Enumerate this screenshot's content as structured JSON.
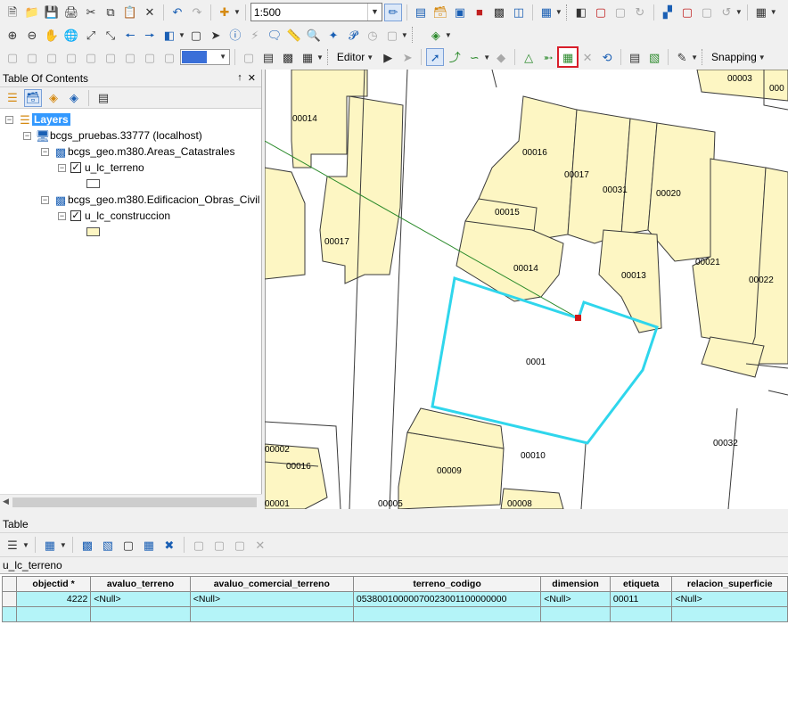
{
  "toolbar": {
    "scale": "1:500",
    "editor_label": "Editor",
    "snapping_label": "Snapping"
  },
  "toc": {
    "title": "Table Of Contents",
    "pin_glyph": "↑",
    "close_glyph": "✕",
    "layers_label": "Layers",
    "database": "bcgs_pruebas.33777 (localhost)",
    "group1": "bcgs_geo.m380.Areas_Catastrales",
    "layer1": "u_lc_terreno",
    "group2": "bcgs_geo.m380.Edificacion_Obras_Civil",
    "layer2": "u_lc_construccion",
    "layer1_swatch_color": "#ffffff",
    "layer2_swatch_color": "#fdf6c3"
  },
  "map": {
    "parcel_fill": "#fdf6c3",
    "selection_color": "#2fd6ec",
    "labels": {
      "l00014a": "00014",
      "l00003": "00003",
      "l00016": "00016",
      "l00017a": "00017",
      "l00031": "00031",
      "l00020": "00020",
      "l00015": "00015",
      "l00017b": "00017",
      "l00014b": "00014",
      "l00013": "00013",
      "l00021": "00021",
      "l00022": "00022",
      "l00011": "0001",
      "l00032": "00032",
      "l00002": "00002",
      "l00016b": "00016",
      "l00009": "00009",
      "l00010": "00010",
      "l00001": "00001",
      "l00005": "00005",
      "l00008": "00008",
      "l0000edge": "000"
    }
  },
  "table": {
    "panel_title": "Table",
    "tab_name": "u_lc_terreno",
    "columns": [
      "objectid *",
      "avaluo_terreno",
      "avaluo_comercial_terreno",
      "terreno_codigo",
      "dimension",
      "etiqueta",
      "relacion_superficie"
    ],
    "rows": [
      [
        "4222",
        "<Null>",
        "<Null>",
        "05380010000070023001100000000",
        "<Null>",
        "00011",
        "<Null>"
      ]
    ]
  }
}
